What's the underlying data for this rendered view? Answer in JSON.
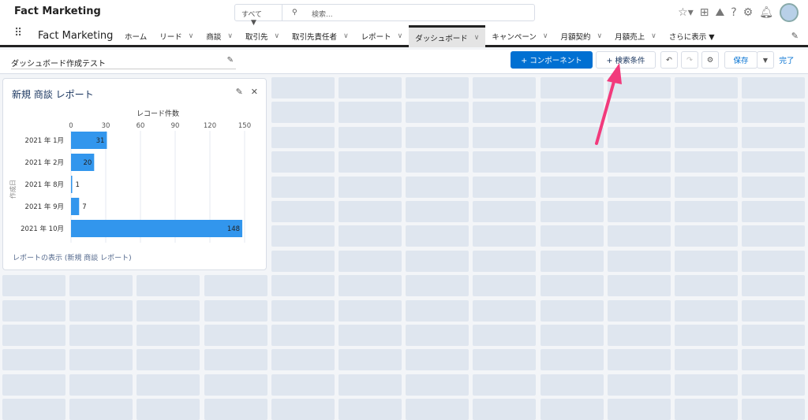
{
  "header": {
    "app_name": "Fact Marketing",
    "search_scope": "すべて",
    "search_placeholder": "検索..."
  },
  "nav": {
    "app_name": "Fact Marketing",
    "tabs": [
      {
        "label": "ホーム",
        "chevron": false
      },
      {
        "label": "リード",
        "chevron": true
      },
      {
        "label": "商談",
        "chevron": true
      },
      {
        "label": "取引先",
        "chevron": true
      },
      {
        "label": "取引先責任者",
        "chevron": true
      },
      {
        "label": "レポート",
        "chevron": true
      },
      {
        "label": "ダッシュボード",
        "chevron": true,
        "active": true
      },
      {
        "label": "キャンペーン",
        "chevron": true
      },
      {
        "label": "月額契約",
        "chevron": true
      },
      {
        "label": "月額売上",
        "chevron": true
      },
      {
        "label": "さらに表示 ▼",
        "chevron": false
      }
    ]
  },
  "toolbar": {
    "dashboard_name": "ダッシュボード作成テスト",
    "component_label": "+ コンポーネント",
    "filter_label": "+ 検索条件",
    "save_label": "保存",
    "done_label": "完了"
  },
  "widget": {
    "title": "新規 商談 レポート",
    "link": "レポートの表示 (新規 商談 レポート)"
  },
  "chart_data": {
    "type": "bar",
    "orientation": "horizontal",
    "xlabel": "レコード件数",
    "ylabel": "作成日",
    "categories": [
      "2021 年 1月",
      "2021 年 2月",
      "2021 年 8月",
      "2021 年 9月",
      "2021 年 10月"
    ],
    "values": [
      31,
      20,
      1,
      7,
      148
    ],
    "xlim": [
      0,
      150
    ],
    "ticks": [
      0,
      30,
      60,
      90,
      120,
      150
    ],
    "grid": true,
    "color": "#3296ed"
  },
  "colors": {
    "brand": "#0070d2",
    "arrow": "#f23a7c"
  }
}
